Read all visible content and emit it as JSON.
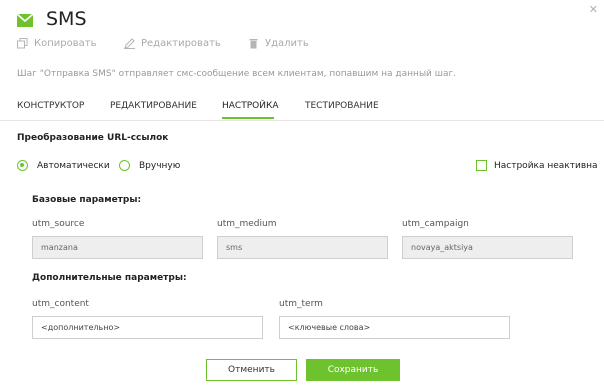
{
  "header": {
    "title": "SMS",
    "icon": "envelope-icon",
    "accent_color": "#6ec22e"
  },
  "toolbar": {
    "copy_label": "Копировать",
    "edit_label": "Редактировать",
    "delete_label": "Удалить"
  },
  "description": "Шаг \"Отправка SMS\" отправляет смс-сообщение всем клиентам, попавшим на данный шаг.",
  "tabs": [
    {
      "label": "КОНСТРУКТОР",
      "active": false
    },
    {
      "label": "РЕДАКТИРОВАНИЕ",
      "active": false
    },
    {
      "label": "НАСТРОЙКА",
      "active": true
    },
    {
      "label": "ТЕСТИРОВАНИЕ",
      "active": false
    }
  ],
  "url_section": {
    "title": "Преобразование URL-ссылок",
    "option_auto": "Автоматически",
    "option_manual": "Вручную",
    "selected": "Автоматически",
    "inactive_checkbox_label": "Настройка неактивна",
    "inactive_checked": false
  },
  "base_params": {
    "title": "Базовые параметры:",
    "fields": [
      {
        "label": "utm_source",
        "value": "manzana"
      },
      {
        "label": "utm_medium",
        "value": "sms"
      },
      {
        "label": "utm_campaign",
        "value": "novaya_aktsiya"
      }
    ]
  },
  "extra_params": {
    "title": "Дополнительные параметры:",
    "fields": [
      {
        "label": "utm_content",
        "placeholder": "<дополнительно>"
      },
      {
        "label": "utm_term",
        "placeholder": "<ключевые слова>"
      }
    ]
  },
  "actions": {
    "cancel_label": "Отменить",
    "save_label": "Сохранить"
  }
}
